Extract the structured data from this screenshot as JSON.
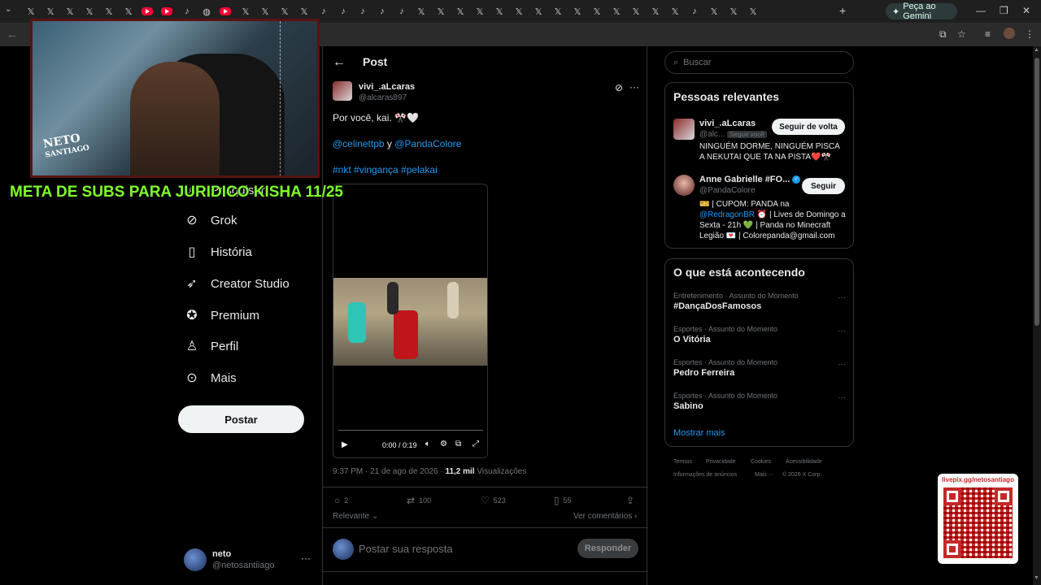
{
  "browser": {
    "tabs": [
      "x",
      "x",
      "x",
      "x",
      "x",
      "x",
      "yt",
      "yt",
      "tt",
      "yt-globe",
      "yt",
      "x",
      "x",
      "x",
      "x",
      "tt",
      "tt",
      "tt",
      "tt",
      "tt",
      "x",
      "x",
      "x",
      "x",
      "x",
      "x",
      "x",
      "x",
      "x",
      "x",
      "x",
      "x",
      "x",
      "x",
      "tt",
      "x",
      "x",
      "x"
    ],
    "gemini_label": "Peça ao Gemini"
  },
  "overlay": {
    "logo_line1": "NETO",
    "logo_line2": "SANTIAGO",
    "banner": "META DE SUBS PARA JURIDICO KISHA 11/25",
    "qr_label": "livepix.gg/netosantiago"
  },
  "nav": {
    "items": [
      {
        "label": "Pesquisar",
        "icon": "search-icon"
      },
      {
        "label": "Grok",
        "icon": "grok-icon"
      },
      {
        "label": "História",
        "icon": "bookmark-icon"
      },
      {
        "label": "Creator Studio",
        "icon": "rocket-icon"
      },
      {
        "label": "Premium",
        "icon": "verified-badge-icon"
      },
      {
        "label": "Perfil",
        "icon": "person-icon"
      },
      {
        "label": "Mais",
        "icon": "more-circle-icon"
      }
    ],
    "post_button": "Postar",
    "account": {
      "name": "neto",
      "handle": "@netosantiiago"
    }
  },
  "post": {
    "header_title": "Post",
    "author_name": "vivi_.aLcaras",
    "author_handle": "@alcaras897",
    "text_line1": "Por você, kai. 🎌🤍",
    "mention1": "@celinettpb",
    "mention_join": " y ",
    "mention2": "@PandaColore",
    "hashtags": "#nkt #vingança #pelakai",
    "video": {
      "time": "0:00 / 0:19"
    },
    "meta_time": "9:37 PM · 21 de ago de 2026 · ",
    "meta_views": "11,2 mil",
    "meta_views_label": " Visualizações",
    "actions": {
      "replies": "2",
      "reposts": "100",
      "likes": "523",
      "bookmarks": "55"
    },
    "relevant_label": "Relevante",
    "see_comments": "Ver comentários",
    "reply_placeholder": "Postar sua resposta",
    "reply_button": "Responder"
  },
  "sidebar": {
    "search_placeholder": "Buscar",
    "relevant_title": "Pessoas relevantes",
    "people": [
      {
        "name": "vivi_.aLcaras",
        "handle": "@alc...",
        "badge": "Segue você",
        "button": "Seguir de volta",
        "bio": "NINGUÉM DORME, NINGUÉM PISCA A NEKUTAI QUE TA NA PISTA❤️🎌"
      },
      {
        "name": "Anne Gabrielle #FO...",
        "handle": "@PandaColore",
        "button": "Seguir",
        "bio_pre": "🎫 | CUPOM: PANDA na ",
        "bio_link": "@RedragonBR",
        "bio_post": "⏰ | Lives de Domingo a Sexta - 21h 💚 | Panda no Minecraft Legião 💌 | Colorepanda@gmail.com"
      }
    ],
    "trends_title": "O que está acontecendo",
    "trends": [
      {
        "category": "Entretenimento · Assunto do Momento",
        "name": "#DançaDosFamosos"
      },
      {
        "category": "Esportes · Assunto do Momento",
        "name": "O Vitória"
      },
      {
        "category": "Esportes · Assunto do Momento",
        "name": "Pedro Ferreira"
      },
      {
        "category": "Esportes · Assunto do Momento",
        "name": "Sabino"
      }
    ],
    "show_more": "Mostrar mais",
    "footer": [
      "Termos",
      "Privacidade",
      "Cookies",
      "Acessibilidade",
      "Informações de anúncios",
      "Mais ···",
      "© 2026 X Corp."
    ]
  },
  "colors": {
    "accent": "#1d9bf0",
    "banner": "#7fff2a",
    "background": "#000000"
  }
}
